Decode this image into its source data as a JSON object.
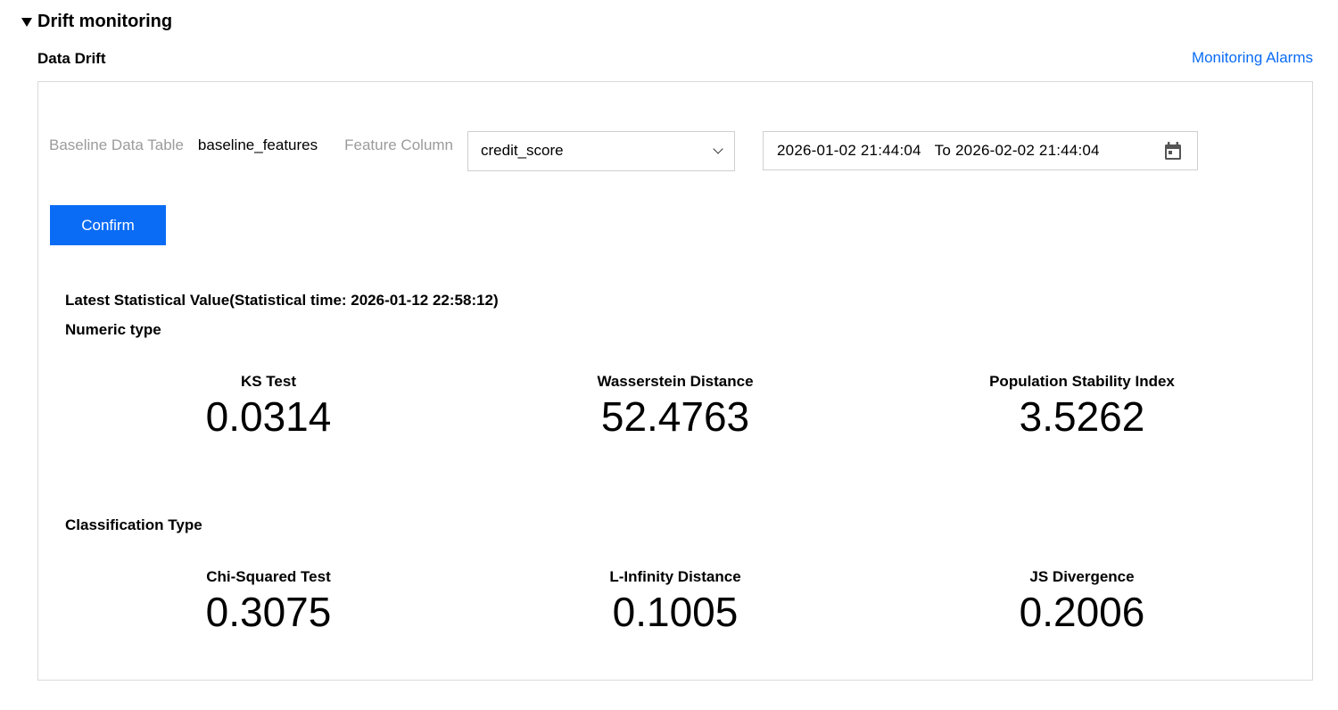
{
  "section": {
    "title": "Drift monitoring",
    "subtitle": "Data Drift",
    "alarms_link": "Monitoring Alarms"
  },
  "filters": {
    "baseline_label": "Baseline Data Table",
    "baseline_value": "baseline_features",
    "feature_label": "Feature Column",
    "feature_selected": "credit_score",
    "date_start": "2026-01-02 21:44:04",
    "date_to_label": "To",
    "date_end": "2026-02-02 21:44:04",
    "confirm_label": "Confirm"
  },
  "stats": {
    "title": "Latest Statistical Value(Statistical time: 2026-01-12 22:58:12)",
    "numeric": {
      "title": "Numeric type",
      "metrics": [
        {
          "label": "KS Test",
          "value": "0.0314"
        },
        {
          "label": "Wasserstein Distance",
          "value": "52.4763"
        },
        {
          "label": "Population Stability Index",
          "value": "3.5262"
        }
      ]
    },
    "classification": {
      "title": "Classification Type",
      "metrics": [
        {
          "label": "Chi-Squared Test",
          "value": "0.3075"
        },
        {
          "label": "L-Infinity Distance",
          "value": "0.1005"
        },
        {
          "label": "JS Divergence",
          "value": "0.2006"
        }
      ]
    }
  },
  "icons": {
    "collapse": "triangle-down-icon",
    "dropdown": "chevron-down-icon",
    "calendar": "calendar-icon"
  },
  "colors": {
    "accent": "#0a6cf5",
    "muted_label": "#9b9b9b",
    "border": "#d9d9d9"
  }
}
